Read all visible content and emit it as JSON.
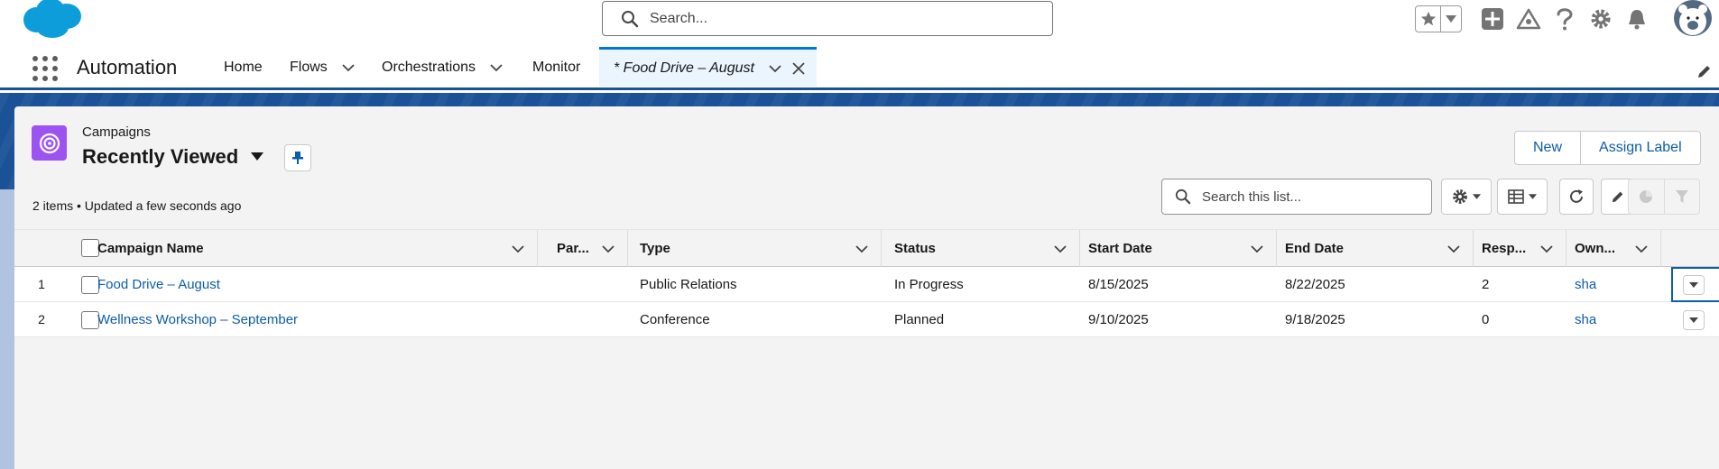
{
  "header": {
    "search_placeholder": "Search..."
  },
  "nav": {
    "app_name": "Automation",
    "items": [
      {
        "label": "Home",
        "has_menu": false
      },
      {
        "label": "Flows",
        "has_menu": true
      },
      {
        "label": "Orchestrations",
        "has_menu": true
      },
      {
        "label": "Monitor",
        "has_menu": false
      }
    ],
    "active_tab": {
      "label": "* Food Drive – August"
    }
  },
  "list_view": {
    "object_label": "Campaigns",
    "title": "Recently Viewed",
    "meta": "2 items • Updated a few seconds ago",
    "search_placeholder": "Search this list...",
    "buttons": {
      "new": "New",
      "assign_label": "Assign Label"
    }
  },
  "table": {
    "columns": [
      "Campaign Name",
      "Par...",
      "Type",
      "Status",
      "Start Date",
      "End Date",
      "Resp...",
      "Own..."
    ],
    "rows": [
      {
        "num": "1",
        "name": "Food Drive – August",
        "parent": "",
        "type": "Public Relations",
        "status": "In Progress",
        "start": "8/15/2025",
        "end": "8/22/2025",
        "responses": "2",
        "owner": "sha"
      },
      {
        "num": "2",
        "name": "Wellness Workshop – September",
        "parent": "",
        "type": "Conference",
        "status": "Planned",
        "start": "9/10/2025",
        "end": "9/18/2025",
        "responses": "0",
        "owner": "sha"
      }
    ]
  },
  "colors": {
    "brand": "#1b5297",
    "link": "#0b5cab",
    "campaign_icon": "#9d53f2",
    "active_tab_bg": "#eaf5fe"
  }
}
